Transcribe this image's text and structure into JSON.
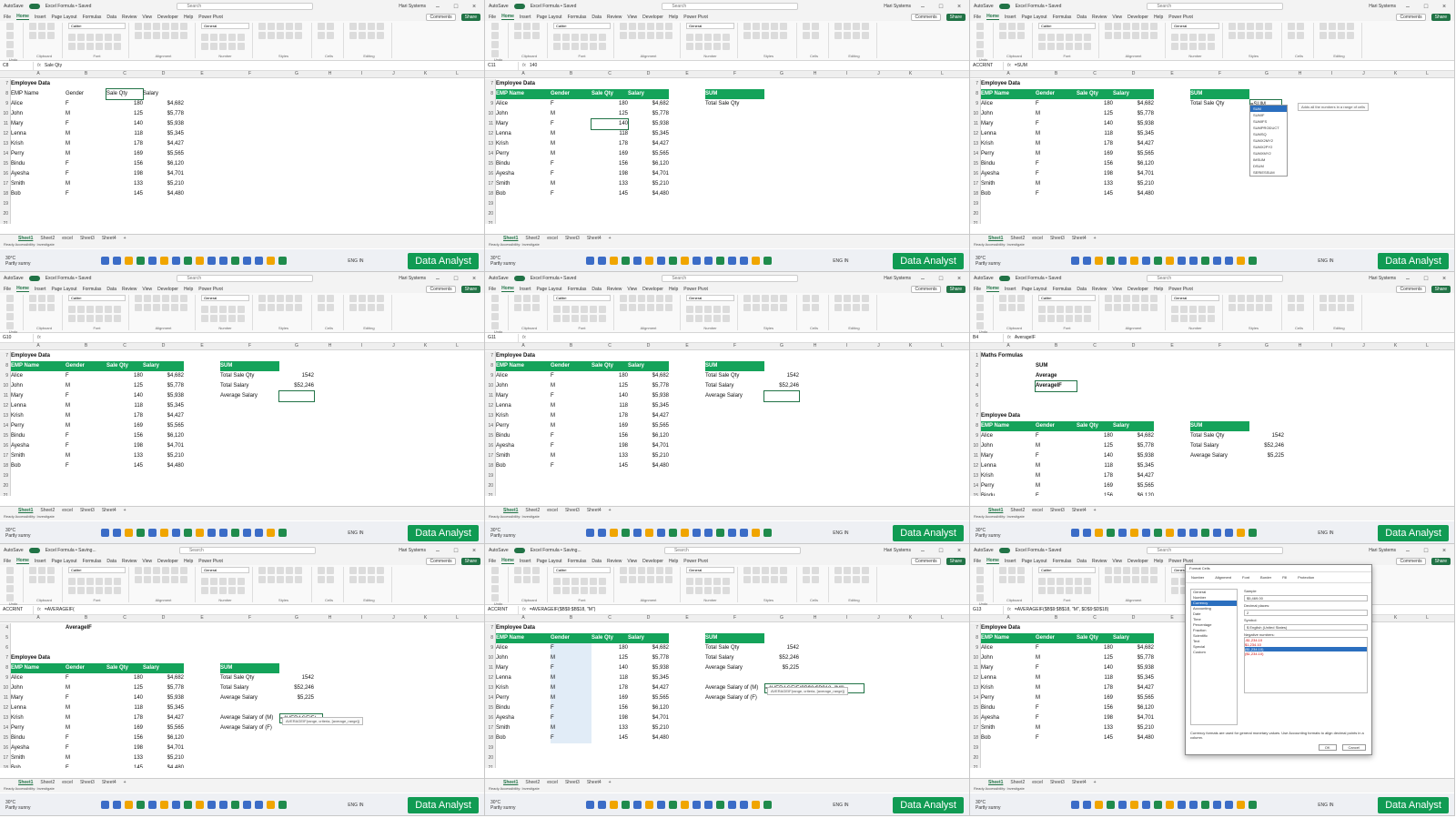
{
  "common": {
    "autosave": "AutoSave",
    "toggle_on": "On",
    "search": "Search",
    "user": "Hari Systems",
    "comments": "Comments",
    "share": "Share",
    "tabs": [
      "File",
      "Home",
      "Insert",
      "Page Layout",
      "Formulas",
      "Data",
      "Review",
      "View",
      "Developer",
      "Help",
      "Power Pivot"
    ],
    "ribbon_groups": [
      "Undo",
      "Clipboard",
      "Font",
      "Alignment",
      "Number",
      "Styles",
      "Cells",
      "Editing"
    ],
    "font_name": "Calibri",
    "font_size": "11",
    "number_format": "General",
    "sheet_tabs": [
      "Sheet1",
      "Sheet2",
      "excel",
      "Sheet3",
      "Sheet4"
    ],
    "status": "Ready",
    "accessibility": "Accessibility: Investigate",
    "weather_temp": "30°C",
    "weather_desc": "Partly sunny",
    "lang": "ENG IN",
    "brand": "Data Analyst"
  },
  "employees": [
    {
      "row": "9",
      "name": "Alice",
      "gender": "F",
      "qty": "180",
      "salary": "$4,682"
    },
    {
      "row": "10",
      "name": "John",
      "gender": "M",
      "qty": "125",
      "salary": "$5,778"
    },
    {
      "row": "11",
      "name": "Mary",
      "gender": "F",
      "qty": "140",
      "salary": "$5,938"
    },
    {
      "row": "12",
      "name": "Lenna",
      "gender": "M",
      "qty": "118",
      "salary": "$5,345"
    },
    {
      "row": "13",
      "name": "Krish",
      "gender": "M",
      "qty": "178",
      "salary": "$4,427"
    },
    {
      "row": "14",
      "name": "Perry",
      "gender": "M",
      "qty": "169",
      "salary": "$5,565"
    },
    {
      "row": "15",
      "name": "Bindu",
      "gender": "F",
      "qty": "156",
      "salary": "$6,120"
    },
    {
      "row": "16",
      "name": "Ayesha",
      "gender": "F",
      "qty": "198",
      "salary": "$4,701"
    },
    {
      "row": "17",
      "name": "Smith",
      "gender": "M",
      "qty": "133",
      "salary": "$5,210"
    },
    {
      "row": "18",
      "name": "Bob",
      "gender": "F",
      "qty": "145",
      "salary": "$4,480"
    }
  ],
  "headers": {
    "section": "Employee Data",
    "emp": "EMP Name",
    "gender": "Gender",
    "qty": "Sale Qty",
    "salary": "Salary"
  },
  "summary": {
    "sum": "SUM",
    "total_qty": "Total Sale Qty",
    "total_qty_val": "1542",
    "total_salary": "Total Salary",
    "total_salary_val": "$52,246",
    "avg_salary": "Average Salary",
    "avg_salary_val": "$5,225",
    "avg_m": "Average Salary of (M)",
    "avg_f": "Average Salary of (F)"
  },
  "panels": [
    {
      "title": "Excel Formula • Saved",
      "namebox": "C8",
      "formula": "Sale Qty"
    },
    {
      "title": "Excel Formula • Saved",
      "namebox": "C11",
      "formula": "140"
    },
    {
      "title": "Excel Formula • Saved",
      "namebox": "ACCRINT",
      "formula": "=SUM",
      "edit": "=SUM",
      "tip": "Adds all the numbers in a range of cells",
      "autocomplete": [
        "SUM",
        "SUMIF",
        "SUMIFS",
        "SUMPRODUCT",
        "SUMSQ",
        "SUMX2MY2",
        "SUMX2PY2",
        "SUMXMY2",
        "IMSUM",
        "DSUM",
        "SERIESSUM"
      ]
    },
    {
      "title": "Excel Formula • Saved",
      "namebox": "G10",
      "formula": ""
    },
    {
      "title": "Excel Formula • Saved",
      "namebox": "G11",
      "formula": ""
    },
    {
      "title": "Excel Formula • Saved",
      "namebox": "B4",
      "formula": "AverageIF",
      "maths": "Maths Formulas",
      "f_sum": "SUM",
      "f_avg": "Average",
      "f_avgif": "AverageIF"
    },
    {
      "title": "Excel Formula • Saving...",
      "namebox": "ACCRINT",
      "formula": "=AVERAGEIF(",
      "heading": "AverageIF",
      "edit": "=AVERAGEIF(",
      "tip": "AVERAGEIF(range, criteria, [average_range])"
    },
    {
      "title": "Excel Formula • Saving...",
      "namebox": "ACCRINT",
      "formula": "=AVERAGEIF($B$9:$B$18, \"M\")",
      "edit": "=AVERAGEIF($B$9:$B$18, \"M\")",
      "tip": "AVERAGEIF(range, criteria, [average_range])"
    },
    {
      "title": "Excel Formula • Saved",
      "namebox": "G13",
      "formula": "=AVERAGEIF($B$9:$B$18, \"M\", $D$9:$D$18)",
      "dialog": {
        "title": "Format Cells",
        "tabs": [
          "Number",
          "Alignment",
          "Font",
          "Border",
          "Fill",
          "Protection"
        ],
        "category_label": "Category:",
        "categories": [
          "General",
          "Number",
          "Currency",
          "Accounting",
          "Date",
          "Time",
          "Percentage",
          "Fraction",
          "Scientific",
          "Text",
          "Special",
          "Custom"
        ],
        "sample_label": "Sample",
        "sample": "$5,469.00",
        "decimal_label": "Decimal places:",
        "decimal": "2",
        "symbol_label": "Symbol:",
        "symbol": "$ English (United States)",
        "neg_label": "Negative numbers:",
        "neg": [
          "-$1,234.10",
          "$1,234.10",
          "($1,234.10)",
          "($1,234.10)"
        ],
        "note": "Currency formats are used for general monetary values. Use Accounting formats to align decimal points in a column.",
        "ok": "OK",
        "cancel": "Cancel"
      }
    }
  ]
}
